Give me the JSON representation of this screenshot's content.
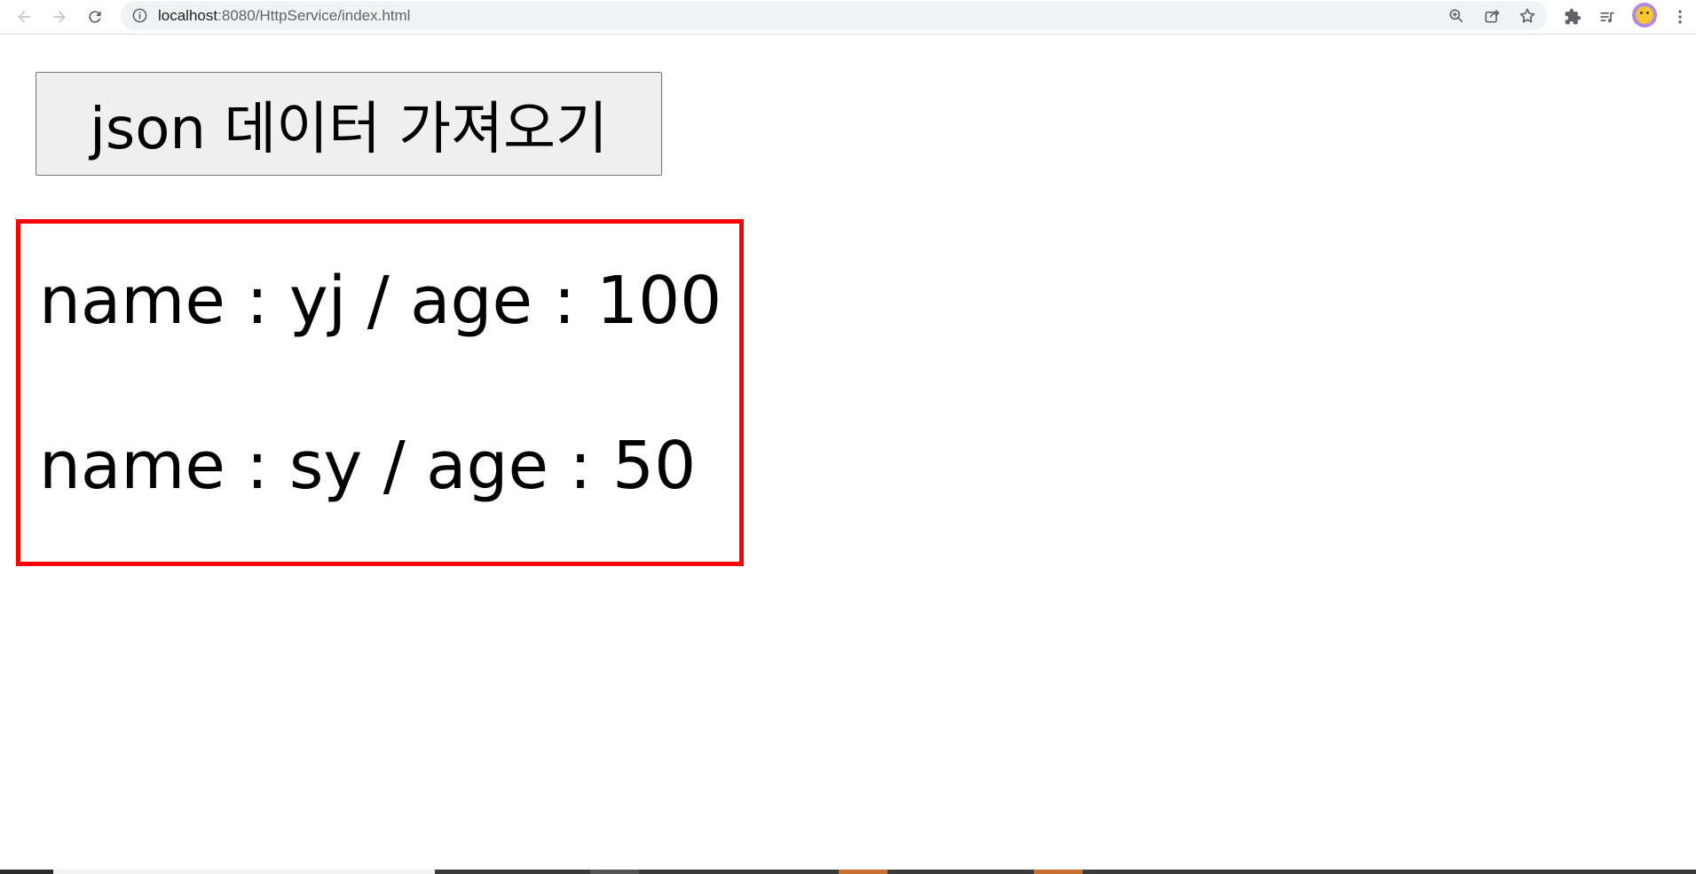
{
  "browser": {
    "url_host": "localhost",
    "url_rest": ":8080/HttpService/index.html",
    "back_icon": "arrow-left-icon",
    "forward_icon": "arrow-right-icon",
    "reload_icon": "reload-icon",
    "colors": {
      "omnibox_bg": "#f1f3f4",
      "icon": "#5f6368",
      "avatar_bg": "#b189e8"
    }
  },
  "page": {
    "fetch_button_label": "json 데이터 가져오기",
    "results": [
      "name : yj / age : 100",
      "name : sy / age : 50"
    ],
    "colors": {
      "result_border": "#ff0000",
      "button_bg": "#efefef"
    }
  }
}
